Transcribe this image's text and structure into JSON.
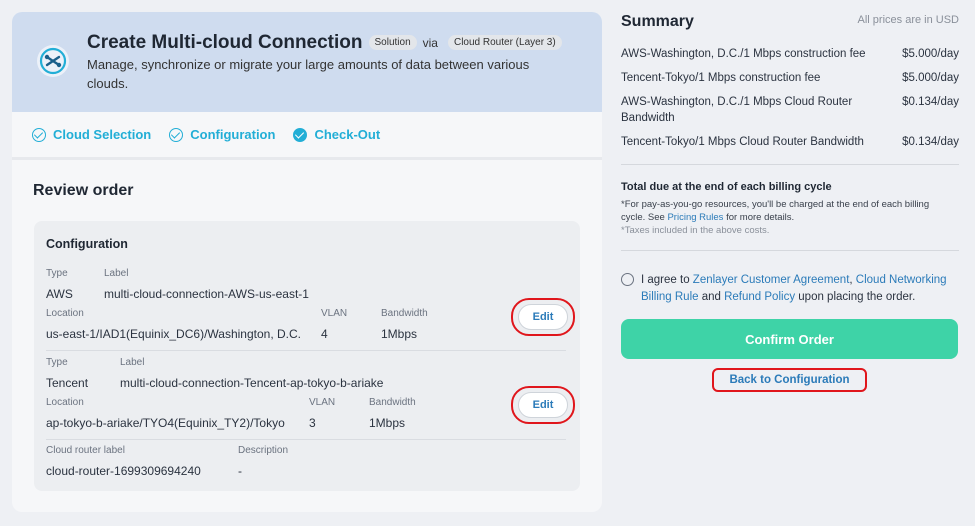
{
  "header": {
    "title": "Create Multi-cloud Connection",
    "badge_solution": "Solution",
    "via": "via",
    "badge_router": "Cloud Router (Layer 3)",
    "description": "Manage, synchronize or migrate your large amounts of data between various clouds."
  },
  "steps": [
    {
      "label": "Cloud Selection"
    },
    {
      "label": "Configuration"
    },
    {
      "label": "Check-Out"
    }
  ],
  "review": {
    "title": "Review order",
    "config_title": "Configuration",
    "labels": {
      "type": "Type",
      "label": "Label",
      "location": "Location",
      "vlan": "VLAN",
      "bandwidth": "Bandwidth",
      "router_label": "Cloud router label",
      "description": "Description"
    },
    "connections": [
      {
        "type": "AWS",
        "label": "multi-cloud-connection-AWS-us-east-1",
        "location": "us-east-1/IAD1(Equinix_DC6)/Washington, D.C.",
        "vlan": "4",
        "bandwidth": "1Mbps",
        "edit": "Edit"
      },
      {
        "type": "Tencent",
        "label": "multi-cloud-connection-Tencent-ap-tokyo-b-ariake",
        "location": "ap-tokyo-b-ariake/TYO4(Equinix_TY2)/Tokyo",
        "vlan": "3",
        "bandwidth": "1Mbps",
        "edit": "Edit"
      }
    ],
    "router": {
      "label": "cloud-router-1699309694240",
      "description": "-"
    }
  },
  "summary": {
    "title": "Summary",
    "prices_note": "All prices are in USD",
    "fees": [
      {
        "name": "AWS-Washington, D.C./1 Mbps construction fee",
        "price": "$5.000/day"
      },
      {
        "name": "Tencent-Tokyo/1 Mbps construction fee",
        "price": "$5.000/day"
      },
      {
        "name": "AWS-Washington, D.C./1 Mbps Cloud Router Bandwidth",
        "price": "$0.134/day"
      },
      {
        "name": "Tencent-Tokyo/1 Mbps Cloud Router Bandwidth",
        "price": "$0.134/day"
      }
    ],
    "total_title": "Total due at the end of each billing cycle",
    "total_note_pre": "*For pay-as-you-go resources, you'll be charged at the end of each billing cycle. See ",
    "total_note_link": "Pricing Rules",
    "total_note_post": " for more details.",
    "tax_note": "*Taxes included in the above costs.",
    "agree": {
      "pre": "I agree to ",
      "link1": "Zenlayer Customer Agreement",
      "sep1": ", ",
      "link2": "Cloud Networking Billing Rule",
      "sep2": " and ",
      "link3": "Refund Policy",
      "post": " upon placing the order."
    },
    "confirm": "Confirm Order",
    "back": "Back to Configuration"
  },
  "colors": {
    "accent": "#22aed6",
    "confirm": "#3ed3a7",
    "link": "#2b7bb9",
    "highlight": "#e0161c"
  }
}
